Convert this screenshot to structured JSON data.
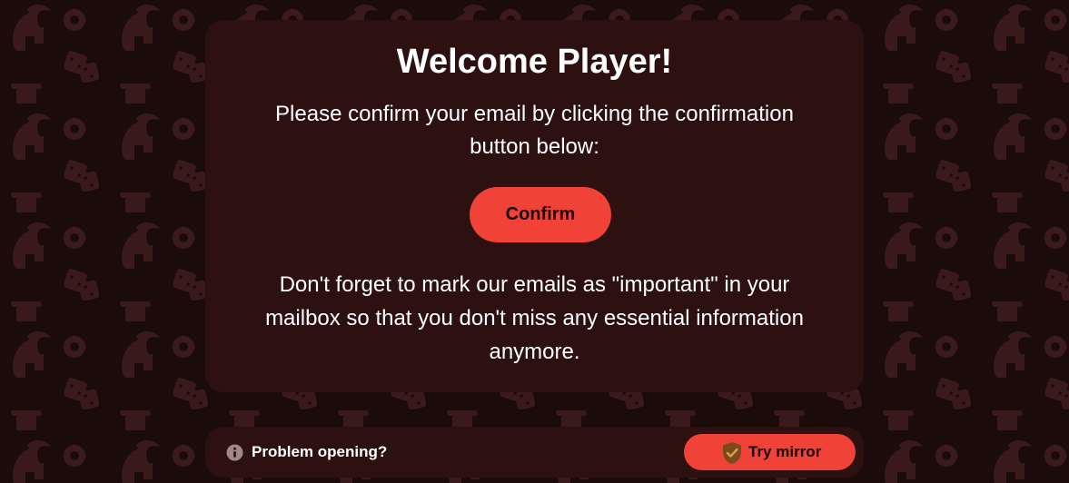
{
  "card": {
    "title": "Welcome Player!",
    "intro": "Please confirm your email by clicking the confirmation button below:",
    "confirm_label": "Confirm",
    "reminder": "Don't forget to mark our emails as \"important\" in your mailbox so that you don't miss any essential information anymore."
  },
  "bottom_bar": {
    "problem_text": "Problem opening?",
    "mirror_label": "Try mirror"
  },
  "icons": {
    "info": "info-icon",
    "shield": "shield-check-icon",
    "background": [
      "spartan-helmet-icon",
      "dice-icon",
      "poker-chip-icon",
      "column-icon"
    ]
  },
  "colors": {
    "background": "#1c0b0b",
    "card": "#2d1111",
    "accent": "#f04236",
    "text": "#ffffff",
    "pattern": "#3a1a1a"
  }
}
